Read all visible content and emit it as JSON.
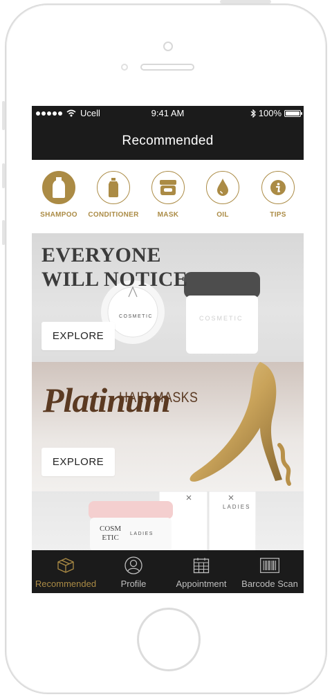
{
  "status_bar": {
    "carrier": "Ucell",
    "time": "9:41 AM",
    "battery": "100%"
  },
  "nav": {
    "title": "Recommended"
  },
  "categories": [
    {
      "label": "SHAMPOO",
      "icon": "bottle-icon",
      "active": true
    },
    {
      "label": "CONDITIONER",
      "icon": "conditioner-icon",
      "active": false
    },
    {
      "label": "MASK",
      "icon": "jar-icon",
      "active": false
    },
    {
      "label": "OIL",
      "icon": "drop-icon",
      "active": false
    },
    {
      "label": "TIPS",
      "icon": "info-icon",
      "active": false
    }
  ],
  "banners": [
    {
      "headline_line1": "EVERYONE",
      "headline_line2": "WILL NOTICE",
      "button": "EXPLORE",
      "jar_small_text": "COSMETIC",
      "jar_big_text": "COSMETIC"
    },
    {
      "title_top": "HAIR MASKS",
      "title_script": "Platinum",
      "button": "EXPLORE"
    },
    {
      "product_text_1": "COSM",
      "product_text_2": "ETIC",
      "brand": "LADIES"
    }
  ],
  "tabs": [
    {
      "label": "Recommended",
      "icon": "box-icon",
      "active": true
    },
    {
      "label": "Profile",
      "icon": "user-icon",
      "active": false
    },
    {
      "label": "Appointment",
      "icon": "calendar-icon",
      "active": false
    },
    {
      "label": "Barcode Scan",
      "icon": "barcode-icon",
      "active": false
    }
  ],
  "colors": {
    "accent": "#ab8b45",
    "bar": "#1b1b1b",
    "tab_inactive": "#bfbfbf"
  }
}
